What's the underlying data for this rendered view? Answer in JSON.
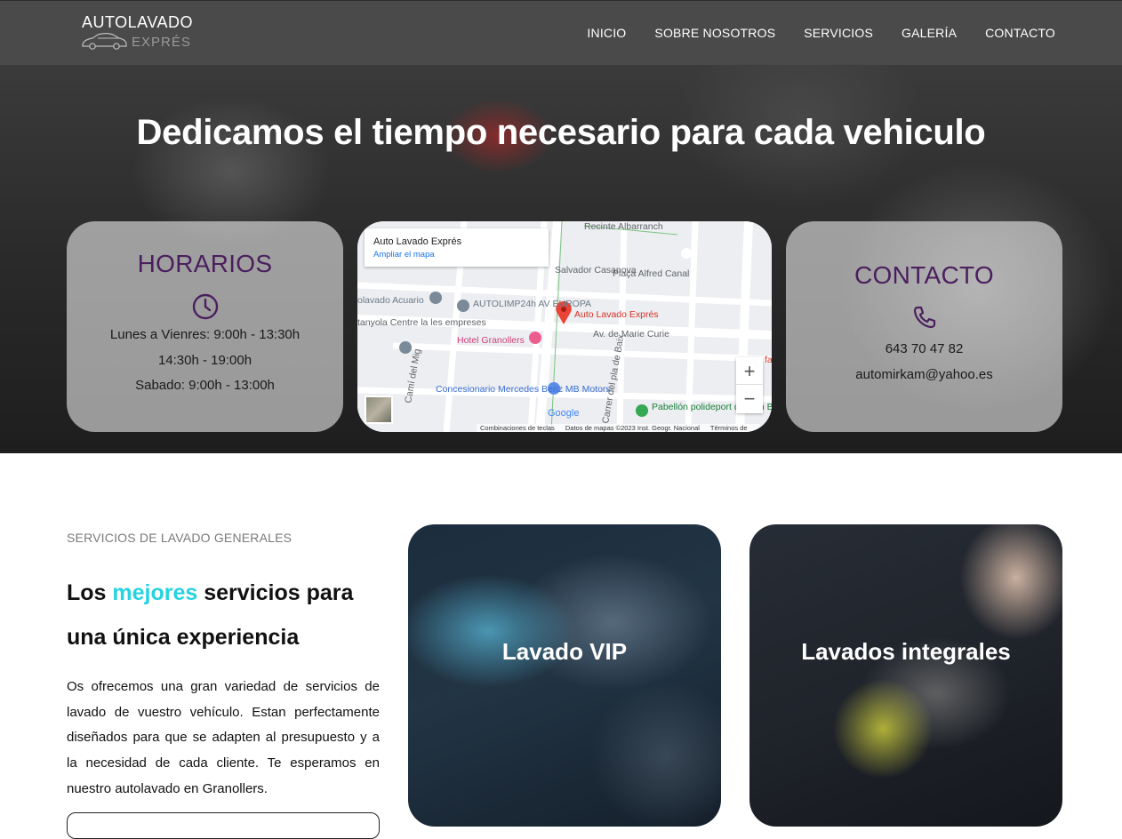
{
  "nav": {
    "logo_line1": "AUTOLAVADO",
    "logo_line2": "EXPRÉS",
    "links": [
      "INICIO",
      "SOBRE NOSOTROS",
      "SERVICIOS",
      "GALERÍA",
      "CONTACTO"
    ]
  },
  "hero": {
    "title": "Dedicamos el tiempo necesario para cada vehiculo",
    "horarios": {
      "heading": "HORARIOS",
      "icon": "clock-icon",
      "lines": [
        "Lunes a Vienres: 9:00h - 13:30h",
        "14:30h - 19:00h",
        "Sabado: 9:00h - 13:00h"
      ]
    },
    "contacto": {
      "heading": "CONTACTO",
      "icon": "phone-icon",
      "phone": "643 70 47 82",
      "email": "automirkam@yahoo.es"
    },
    "map": {
      "place_name": "Auto Lavado Exprés",
      "enlarge_link": "Ampliar el mapa",
      "labels": [
        "Recinte Albarranch",
        "Salvador Casanova",
        "Plaça Alfred Canal",
        "olavado Acuario",
        "AUTOLIMP24h AV EUROPA",
        "Auto Lavado Exprés",
        "tanyola Centre la les empreses",
        "Hotel Granollers",
        "Av. de Marie Curie",
        "Camí del Mig",
        "Concesionario Mercedes Benz MB Motors",
        "Carrer del pla de Baix",
        "Pabellón polideport de Can Bassa",
        "Google",
        "fa"
      ],
      "zoom_in": "+",
      "zoom_out": "−",
      "footer": [
        "Combinaciones de teclas",
        "Datos de mapas ©2023 Inst. Geogr. Nacional",
        "Términos de"
      ]
    }
  },
  "services_section": {
    "label": "SERVICIOS DE LAVADO GENERALES",
    "title_pre": "Los ",
    "title_hl": "mejores",
    "title_post": " servicios para una única experiencia",
    "text": "Os ofrecemos una gran variedad de servicios de lavado de vuestro vehículo. Estan perfectamente diseñados para que se adapten al presupuesto y a la necesidad de cada cliente. Te esperamos en nuestro autolavado en Granollers.",
    "cards": [
      {
        "title": "Lavado VIP"
      },
      {
        "title": "Lavados integrales"
      }
    ]
  },
  "colors": {
    "nav_bg": "#4a4a4a",
    "card_heading": "#4b1f5e",
    "highlight": "#26d3e0"
  }
}
